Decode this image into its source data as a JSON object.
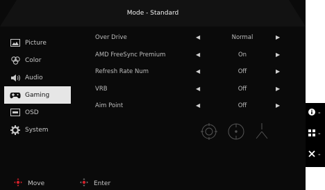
{
  "header": {
    "title": "Mode - Standard"
  },
  "sidebar": {
    "items": [
      {
        "label": "Picture",
        "icon": "picture-icon",
        "active": false
      },
      {
        "label": "Color",
        "icon": "color-icon",
        "active": false
      },
      {
        "label": "Audio",
        "icon": "audio-icon",
        "active": false
      },
      {
        "label": "Gaming",
        "icon": "gamepad-icon",
        "active": true
      },
      {
        "label": "OSD",
        "icon": "osd-icon",
        "active": false
      },
      {
        "label": "System",
        "icon": "system-icon",
        "active": false
      }
    ]
  },
  "settings": [
    {
      "label": "Over Drive",
      "value": "Normal"
    },
    {
      "label": "AMD FreeSync Premium",
      "value": "On"
    },
    {
      "label": "Refresh Rate Num",
      "value": "Off"
    },
    {
      "label": "VRB",
      "value": "Off"
    },
    {
      "label": "Aim Point",
      "value": "Off"
    }
  ],
  "footer": {
    "move_label": "Move",
    "enter_label": "Enter"
  },
  "side_keys": [
    {
      "icon": "info-icon",
      "text": "-"
    },
    {
      "icon": "menu-grid-icon",
      "text": "-"
    },
    {
      "icon": "close-icon",
      "text": "-"
    }
  ],
  "colors": {
    "background": "#0a0a0a",
    "active_item": "#e6e6e6",
    "accent_red": "#d0202a"
  }
}
